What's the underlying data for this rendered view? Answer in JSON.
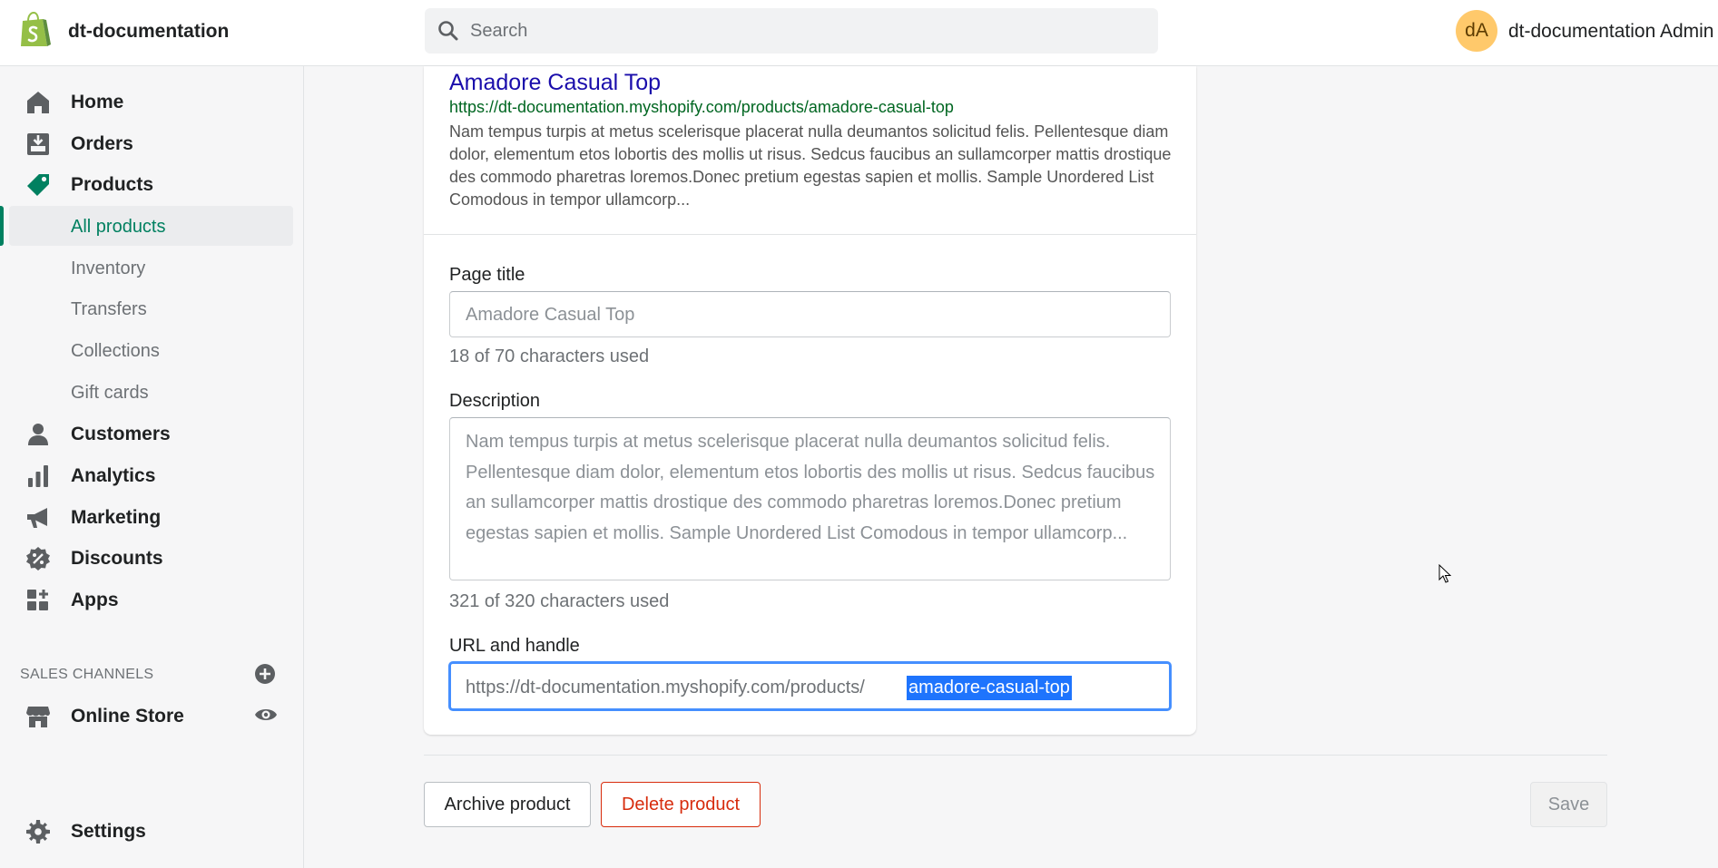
{
  "topbar": {
    "store_name": "dt-documentation",
    "search_placeholder": "Search",
    "avatar_initials": "dA",
    "user_name": "dt-documentation Admin",
    "logo_icon": "shopify-bag-icon"
  },
  "sidebar": {
    "items": [
      {
        "label": "Home",
        "icon": "home-icon"
      },
      {
        "label": "Orders",
        "icon": "orders-icon"
      },
      {
        "label": "Products",
        "icon": "tag-icon"
      },
      {
        "label": "Customers",
        "icon": "person-icon"
      },
      {
        "label": "Analytics",
        "icon": "bar-chart-icon"
      },
      {
        "label": "Marketing",
        "icon": "megaphone-icon"
      },
      {
        "label": "Discounts",
        "icon": "discount-icon"
      },
      {
        "label": "Apps",
        "icon": "apps-icon"
      }
    ],
    "product_subitems": [
      {
        "label": "All products",
        "active": true
      },
      {
        "label": "Inventory"
      },
      {
        "label": "Transfers"
      },
      {
        "label": "Collections"
      },
      {
        "label": "Gift cards"
      }
    ],
    "sales_channels_title": "SALES CHANNELS",
    "online_store": "Online Store",
    "settings": "Settings"
  },
  "seo": {
    "preview_title": "Amadore Casual Top",
    "preview_url": "https://dt-documentation.myshopify.com/products/amadore-casual-top",
    "preview_description": "Nam tempus turpis at metus scelerisque placerat nulla deumantos solicitud felis. Pellentesque diam dolor, elementum etos lobortis des mollis ut risus. Sedcus faucibus an sullamcorper mattis drostique des commodo pharetras loremos.Donec pretium egestas sapien et mollis. Sample Unordered List Comodous in tempor ullamcorp...",
    "page_title_label": "Page title",
    "page_title_placeholder": "Amadore Casual Top",
    "page_title_help": "18 of 70 characters used",
    "description_label": "Description",
    "description_placeholder": "Nam tempus turpis at metus scelerisque placerat nulla deumantos solicitud felis. Pellentesque diam dolor, elementum etos lobortis des mollis ut risus. Sedcus faucibus an sullamcorper mattis drostique des commodo pharetras loremos.Donec pretium egestas sapien et mollis. Sample Unordered List Comodous in tempor ullamcorp...",
    "description_help": "321 of 320 characters used",
    "url_label": "URL and handle",
    "url_prefix": "https://dt-documentation.myshopify.com/products/",
    "url_handle": "amadore-casual-top"
  },
  "actions": {
    "archive": "Archive product",
    "delete": "Delete product",
    "save": "Save"
  },
  "colors": {
    "accent": "#008060",
    "focus": "#458fff",
    "danger": "#d72c0d",
    "link": "#1a0dab",
    "url_green": "#006621"
  }
}
